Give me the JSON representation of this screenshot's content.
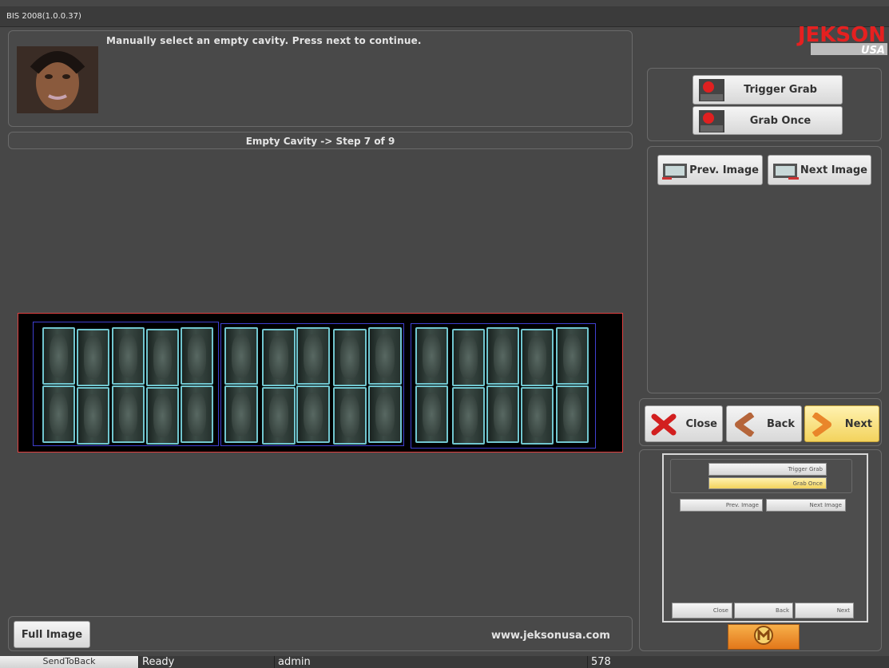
{
  "window": {
    "title": "BIS 2008(1.0.0.37)"
  },
  "header": {
    "instruction": "Manually select an empty cavity. Press next to continue."
  },
  "step_bar": {
    "text": "Empty Cavity -> Step 7 of 9"
  },
  "logo": {
    "text": "JEKSON",
    "subtext": "USA"
  },
  "grab": {
    "trigger_label": "Trigger Grab",
    "once_label": "Grab Once"
  },
  "image_nav": {
    "prev_label": "Prev. Image",
    "next_label": "Next Image"
  },
  "nav": {
    "close_label": "Close",
    "back_label": "Back",
    "next_label": "Next"
  },
  "footer": {
    "full_image_label": "Full Image",
    "website": "www.jeksonusa.com"
  },
  "mini_preview": {
    "trigger_label": "Trigger Grab",
    "once_label": "Grab Once",
    "prev_label": "Prev. Image",
    "next_image_label": "Next Image",
    "close_label": "Close",
    "back_label": "Back",
    "next_label": "Next"
  },
  "statusbar": {
    "send_to_back": "SendToBack",
    "state": "Ready",
    "user": "admin",
    "value": "578"
  },
  "colors": {
    "accent_orange": "#f39b2a",
    "cavity_outline": "#71c6cf",
    "group_outline": "#3f3fd0",
    "image_border": "#e04040"
  }
}
